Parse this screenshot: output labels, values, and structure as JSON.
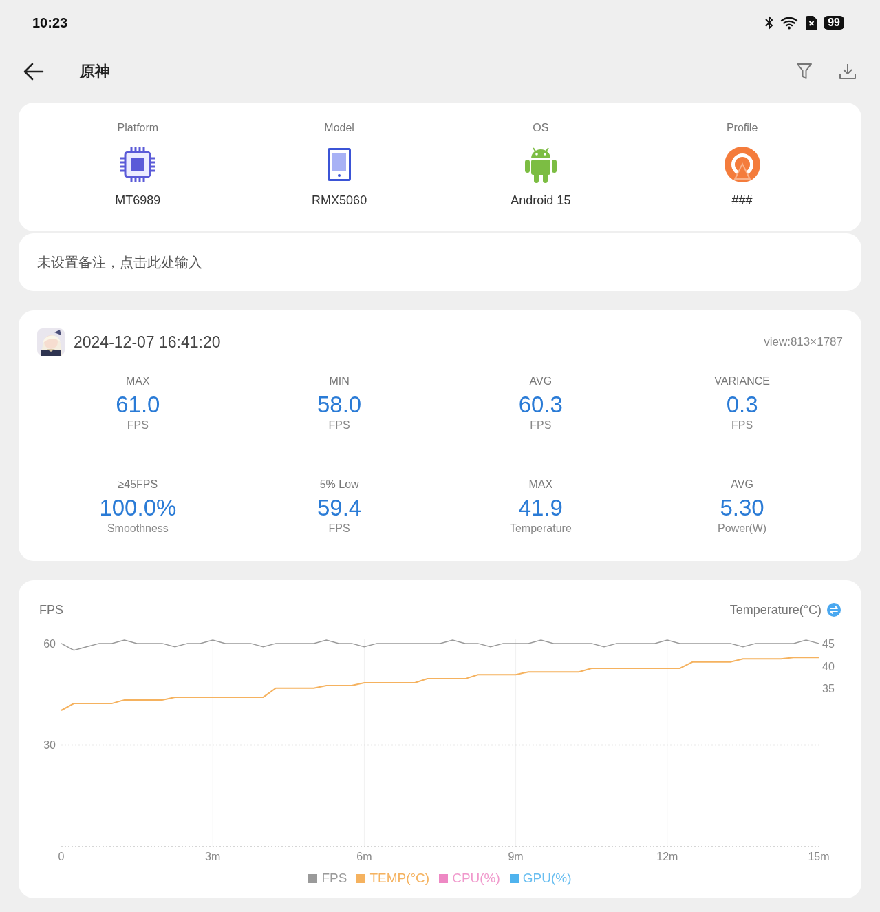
{
  "status_bar": {
    "time": "10:23",
    "battery": "99"
  },
  "header": {
    "title": "原神"
  },
  "device_info": [
    {
      "label": "Platform",
      "value": "MT6989",
      "kind": "chip"
    },
    {
      "label": "Model",
      "value": "RMX5060",
      "kind": "tablet"
    },
    {
      "label": "OS",
      "value": "Android 15",
      "kind": "android"
    },
    {
      "label": "Profile",
      "value": "###",
      "kind": "profile"
    }
  ],
  "note": {
    "placeholder": "未设置备注，点击此处输入"
  },
  "session": {
    "timestamp": "2024-12-07 16:41:20",
    "view": "view:813×1787",
    "stats": [
      {
        "label": "MAX",
        "value": "61.0",
        "unit": "FPS"
      },
      {
        "label": "MIN",
        "value": "58.0",
        "unit": "FPS"
      },
      {
        "label": "AVG",
        "value": "60.3",
        "unit": "FPS"
      },
      {
        "label": "VARIANCE",
        "value": "0.3",
        "unit": "FPS"
      },
      {
        "label": "≥45FPS",
        "value": "100.0%",
        "unit": "Smoothness"
      },
      {
        "label": "5% Low",
        "value": "59.4",
        "unit": "FPS"
      },
      {
        "label": "MAX",
        "value": "41.9",
        "unit": "Temperature"
      },
      {
        "label": "AVG",
        "value": "5.30",
        "unit": "Power(W)"
      }
    ]
  },
  "chart": {
    "chart_data": {
      "type": "line",
      "ylabel": "FPS",
      "y2label": "Temperature(°C)",
      "x": [
        0,
        0.25,
        0.5,
        0.75,
        1,
        1.25,
        1.5,
        1.75,
        2,
        2.25,
        2.5,
        2.75,
        3,
        3.25,
        3.5,
        3.75,
        4,
        4.25,
        4.5,
        4.75,
        5,
        5.25,
        5.5,
        5.75,
        6,
        6.25,
        6.5,
        6.75,
        7,
        7.25,
        7.5,
        7.75,
        8,
        8.25,
        8.5,
        8.75,
        9,
        9.25,
        9.5,
        9.75,
        10,
        10.25,
        10.5,
        10.75,
        11,
        11.25,
        11.5,
        11.75,
        12,
        12.25,
        12.5,
        12.75,
        13,
        13.25,
        13.5,
        13.75,
        14,
        14.25,
        14.5,
        14.75,
        15
      ],
      "series": [
        {
          "name": "FPS",
          "color": "#9a9a9a",
          "values": [
            60,
            58,
            59,
            60,
            60,
            61,
            60,
            60,
            60,
            59,
            60,
            60,
            61,
            60,
            60,
            60,
            59,
            60,
            60,
            60,
            60,
            61,
            60,
            60,
            59,
            60,
            60,
            60,
            60,
            60,
            60,
            61,
            60,
            60,
            59,
            60,
            60,
            60,
            61,
            60,
            60,
            60,
            60,
            59,
            60,
            60,
            60,
            60,
            61,
            60,
            60,
            60,
            60,
            60,
            59,
            60,
            60,
            60,
            60,
            61,
            60
          ]
        },
        {
          "name": "TEMP(°C)",
          "color": "#f5b25f",
          "axis": "y2",
          "values": [
            30.2,
            31.7,
            31.7,
            31.7,
            31.7,
            32.5,
            32.5,
            32.5,
            32.5,
            33.1,
            33.1,
            33.1,
            33.1,
            33.1,
            33.1,
            33.1,
            33.1,
            35.1,
            35.1,
            35.1,
            35.1,
            35.7,
            35.7,
            35.7,
            36.3,
            36.3,
            36.3,
            36.3,
            36.3,
            37.2,
            37.2,
            37.2,
            37.2,
            38.1,
            38.1,
            38.1,
            38.1,
            38.7,
            38.7,
            38.7,
            38.7,
            38.7,
            39.5,
            39.5,
            39.5,
            39.5,
            39.5,
            39.5,
            39.5,
            39.5,
            40.9,
            40.9,
            40.9,
            40.9,
            41.6,
            41.6,
            41.6,
            41.6,
            41.9,
            41.9,
            41.9
          ]
        }
      ],
      "xlim": [
        0,
        15
      ],
      "ylim": [
        0,
        61.2
      ],
      "y2lim": [
        0,
        45.9
      ],
      "xticks": [
        0,
        {
          "value": 3,
          "label": "3m"
        },
        {
          "value": 6,
          "label": "6m"
        },
        {
          "value": 9,
          "label": "9m"
        },
        {
          "value": 12,
          "label": "12m"
        },
        {
          "value": 15,
          "label": "15m"
        }
      ],
      "yticks": [
        30,
        60
      ],
      "y2ticks": [
        35,
        40,
        45
      ],
      "grid": true,
      "ref_lines": [
        {
          "axis": "y",
          "value": 30
        }
      ],
      "legend": "bottom"
    },
    "legend": [
      {
        "label": "CPU(%)",
        "color": "#ee88c4",
        "on": false
      },
      {
        "label": "GPU(%)",
        "color": "#4fb3ee",
        "on": false
      }
    ]
  }
}
